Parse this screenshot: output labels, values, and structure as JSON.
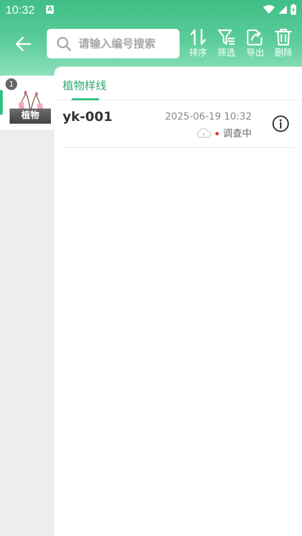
{
  "status_bar": {
    "time": "10:32",
    "notification_icon": "A"
  },
  "header": {
    "back_icon": "arrow-left-icon",
    "search": {
      "placeholder": "请输入编号搜索",
      "value": ""
    },
    "actions": [
      {
        "label": "排序",
        "icon": "sort-icon"
      },
      {
        "label": "筛选",
        "icon": "filter-icon"
      },
      {
        "label": "导出",
        "icon": "export-icon"
      },
      {
        "label": "删除",
        "icon": "delete-icon"
      }
    ]
  },
  "sidebar": {
    "categories": [
      {
        "label": "植物",
        "count": "1",
        "selected": true
      }
    ]
  },
  "main": {
    "tabs": [
      {
        "label": "植物样线",
        "active": true
      }
    ],
    "records": [
      {
        "name": "yk-001",
        "datetime": "2025-06-19 10:32",
        "status": "调查中",
        "status_color": "#e53935",
        "sync_icon": "cloud-icon",
        "info_icon": "info-icon"
      }
    ]
  },
  "colors": {
    "accent": "#2fbf7f",
    "header_top": "#3fbe86",
    "tab_text": "#2fa872"
  }
}
